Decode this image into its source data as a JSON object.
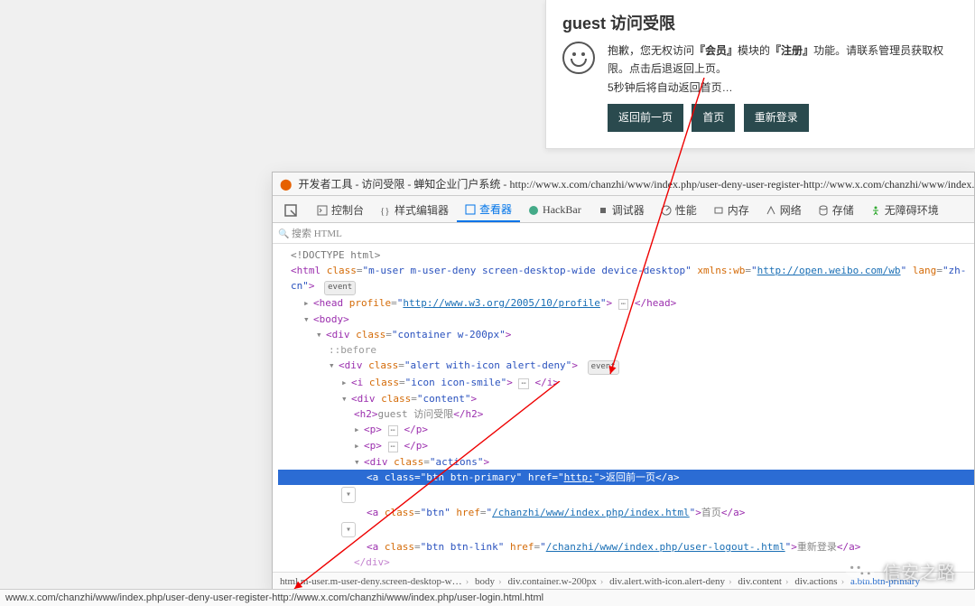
{
  "alert": {
    "title": "guest 访问受限",
    "line1_pre": "抱歉，您无权访问",
    "bold1": "『会员』",
    "mid1": "模块的",
    "bold2": "『注册』",
    "line1_post": "功能。请联系管理员获取权限。点击后退返回上页。",
    "line2": "5秒钟后将自动返回首页…",
    "btn_back": "返回前一页",
    "btn_home": "首页",
    "btn_relogin": "重新登录"
  },
  "devtools": {
    "window_title_pre": "开发者工具 - 访问受限 - 蝉知企业门户系统 - ",
    "window_url": "http://www.x.com/chanzhi/www/index.php/user-deny-user-register-http://www.x.com/chanzhi/www/index.php/user",
    "tabs": {
      "console": "控制台",
      "style": "样式编辑器",
      "inspector": "查看器",
      "hackbar": "HackBar",
      "debugger": "调试器",
      "performance": "性能",
      "memory": "内存",
      "network": "网络",
      "storage": "存储",
      "a11y": "无障碍环境"
    },
    "search_placeholder": "搜索 HTML",
    "code": {
      "doctype": "<!DOCTYPE html>",
      "html_open_pre": "<html class=\"",
      "html_classes": "m-user m-user-deny screen-desktop-wide device-desktop",
      "html_mid": "\" xmlns:wb=\"",
      "html_xmlns": "http://open.weibo.com/wb",
      "html_lang": "\" lang=\"zh-cn\">",
      "event": "event",
      "head": "<head profile=\"http://www.w3.org/2005/10/profile\"> ⋯ </head>",
      "body_open": "<body>",
      "div_container": "<div class=\"container w-200px\">",
      "before": "::before",
      "div_alert": "<div class=\"alert with-icon alert-deny\">",
      "i_icon": "<i class=\"icon icon-smile\"> ⋯ </i>",
      "div_content": "<div class=\"content\">",
      "h2": "<h2>guest 访问受限</h2>",
      "p1": "<p> ⋯ </p>",
      "p2": "<p> ⋯ </p>",
      "div_actions": "<div class=\"actions\">",
      "a1_pre": "<a class=\"btn btn-primary\" href=\"",
      "a1_href": "http:",
      "a1_text": "\">返回前一页</a>",
      "a2_pre": "<a class=\"btn\" href=\"",
      "a2_href": "/chanzhi/www/index.php/index.html",
      "a2_text": "\">首页</a>",
      "a3_pre": "<a class=\"btn btn-link\" href=\"",
      "a3_href": "/chanzhi/www/index.php/user-logout-.html",
      "a3_text": "\">重新登录</a>",
      "div_close": "</div>"
    },
    "breadcrumb": [
      "html.m-user.m-user-deny.screen-desktop-w…",
      "body",
      "div.container.w-200px",
      "div.alert.with-icon.alert-deny",
      "div.content",
      "div.actions",
      "a.btn.btn-primary"
    ]
  },
  "status_url": "www.x.com/chanzhi/www/index.php/user-deny-user-register-http://www.x.com/chanzhi/www/index.php/user-login.html.html",
  "watermark": "信安之路"
}
